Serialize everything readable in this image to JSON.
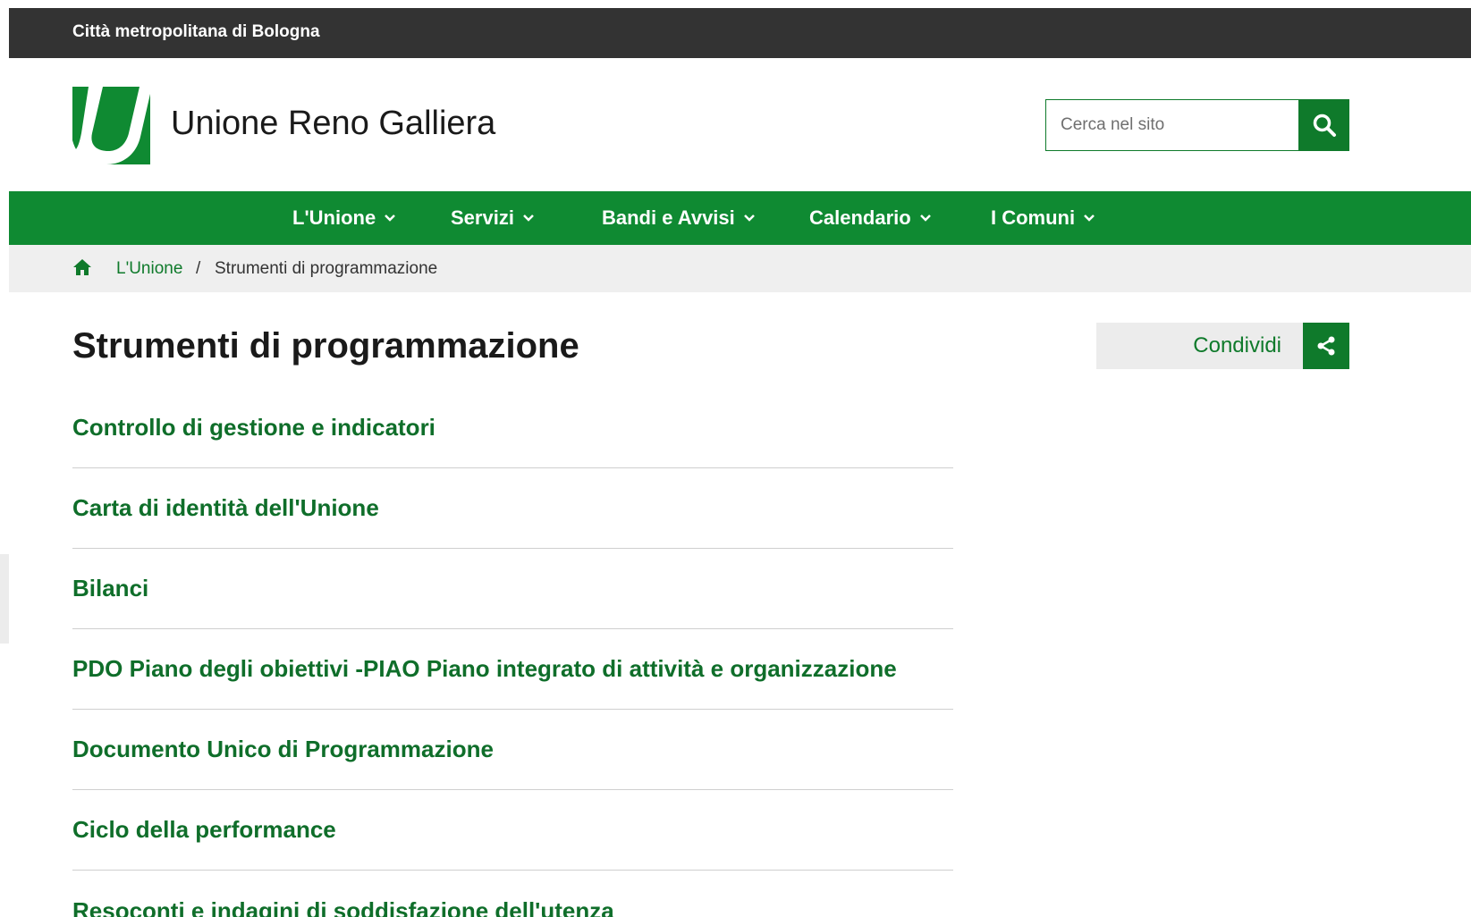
{
  "topbar": {
    "org": "Città metropolitana di Bologna"
  },
  "header": {
    "site_title": "Unione Reno Galliera",
    "logo_icon": "unione-u-logo",
    "search_placeholder": "Cerca nel sito"
  },
  "nav": {
    "items": [
      {
        "label": "L'Unione"
      },
      {
        "label": "Servizi"
      },
      {
        "label": "Bandi e Avvisi"
      },
      {
        "label": "Calendario"
      },
      {
        "label": "I Comuni"
      }
    ]
  },
  "breadcrumb": {
    "home_icon": "home-icon",
    "items": [
      {
        "label": "L'Unione"
      },
      {
        "label": "Strumenti di programmazione"
      }
    ],
    "separator": "/"
  },
  "main": {
    "title": "Strumenti di programmazione",
    "share_label": "Condividi",
    "links": [
      {
        "label": "Controllo di gestione e indicatori"
      },
      {
        "label": "Carta di identità dell'Unione"
      },
      {
        "label": "Bilanci"
      },
      {
        "label": "PDO Piano degli obiettivi -PIAO Piano integrato di attività e organizzazione"
      },
      {
        "label": "Documento Unico di Programmazione"
      },
      {
        "label": "Ciclo della performance"
      },
      {
        "label": "Resoconti e indagini di soddisfazione dell'utenza"
      }
    ]
  },
  "colors": {
    "brand_green": "#0f8a32",
    "link_green": "#0f6e2a",
    "topbar": "#333333"
  }
}
